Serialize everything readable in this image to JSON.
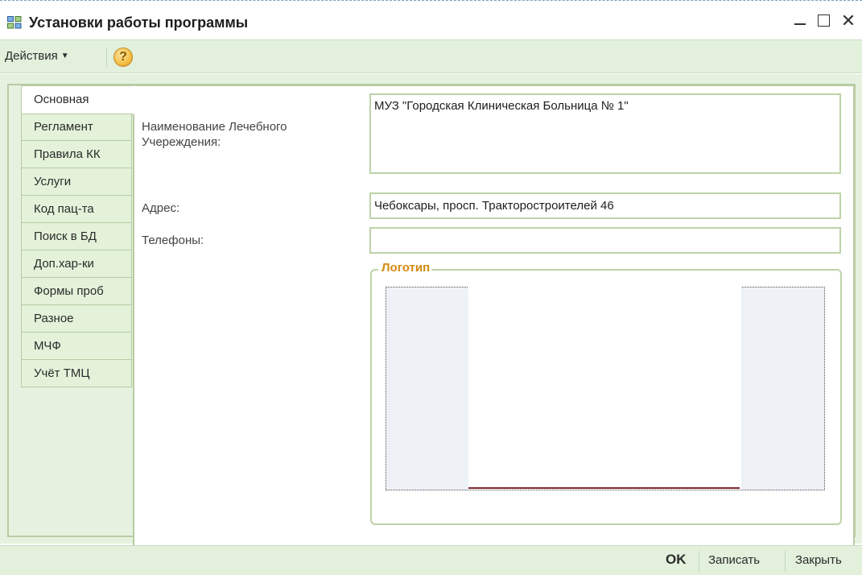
{
  "window": {
    "title": "Установки работы программы",
    "minimize_label": "_",
    "close_label": "✕"
  },
  "toolbar": {
    "actions_label": "Действия",
    "help_label": "?"
  },
  "tabs": [
    {
      "label": "Основная",
      "active": true
    },
    {
      "label": "Регламент",
      "active": false
    },
    {
      "label": "Правила КК",
      "active": false
    },
    {
      "label": "Услуги",
      "active": false
    },
    {
      "label": "Код пац-та",
      "active": false
    },
    {
      "label": "Поиск в БД",
      "active": false
    },
    {
      "label": "Доп.хар-ки",
      "active": false
    },
    {
      "label": "Формы проб",
      "active": false
    },
    {
      "label": "Разное",
      "active": false
    },
    {
      "label": "МЧФ",
      "active": false
    },
    {
      "label": "Учёт ТМЦ",
      "active": false
    }
  ],
  "form": {
    "institution_label_line1": "Наименование Лечебного",
    "institution_label_line2": "Учереждения:",
    "institution_value": "МУЗ \"Городская Клиническая Больница № 1\"",
    "address_label": "Адрес:",
    "address_value": "Чебоксары, просп. Тракторостроителей 46",
    "phones_label": "Телефоны:",
    "phones_value": "",
    "logo_group_label": "Логотип"
  },
  "footer": {
    "ok_label": "OK",
    "save_label": "Записать",
    "close_label": "Закрыть"
  },
  "colors": {
    "accent_green": "#e2f0dc",
    "tab_border": "#b9cba4",
    "logo_label": "#d38a10"
  }
}
